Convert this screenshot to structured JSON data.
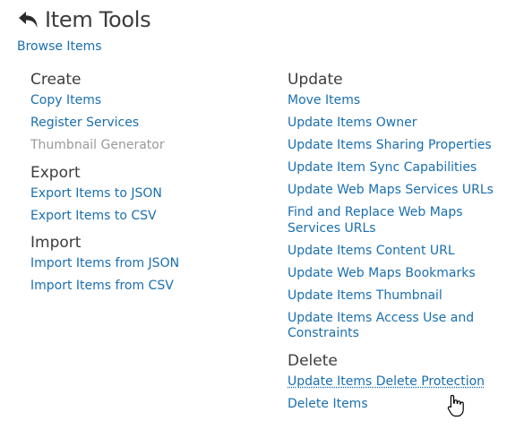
{
  "header": {
    "back_icon": "undo-arrow-icon",
    "title": "Item Tools"
  },
  "breadcrumb": {
    "browse_label": "Browse Items"
  },
  "left_column": {
    "create": {
      "heading": "Create",
      "items": [
        "Copy Items",
        "Register Services",
        "Thumbnail Generator"
      ]
    },
    "export": {
      "heading": "Export",
      "items": [
        "Export Items to JSON",
        "Export Items to CSV"
      ]
    },
    "import": {
      "heading": "Import",
      "items": [
        "Import Items from JSON",
        "Import Items from CSV"
      ]
    }
  },
  "right_column": {
    "update": {
      "heading": "Update",
      "items": [
        "Move Items",
        "Update Items Owner",
        "Update Items Sharing Properties",
        "Update Item Sync Capabilities",
        "Update Web Maps Services URLs",
        "Find and Replace Web Maps Services URLs",
        "Update Items Content URL",
        "Update Web Maps Bookmarks",
        "Update Items Thumbnail",
        "Update Items Access Use and Constraints"
      ]
    },
    "delete": {
      "heading": "Delete",
      "items": [
        "Update Items Delete Protection",
        "Delete Items"
      ]
    }
  },
  "colors": {
    "link": "#1a6fb0",
    "disabled": "#9a9a9a",
    "heading": "#3c3c3c"
  },
  "cursor_icon": "hand-pointer-icon"
}
